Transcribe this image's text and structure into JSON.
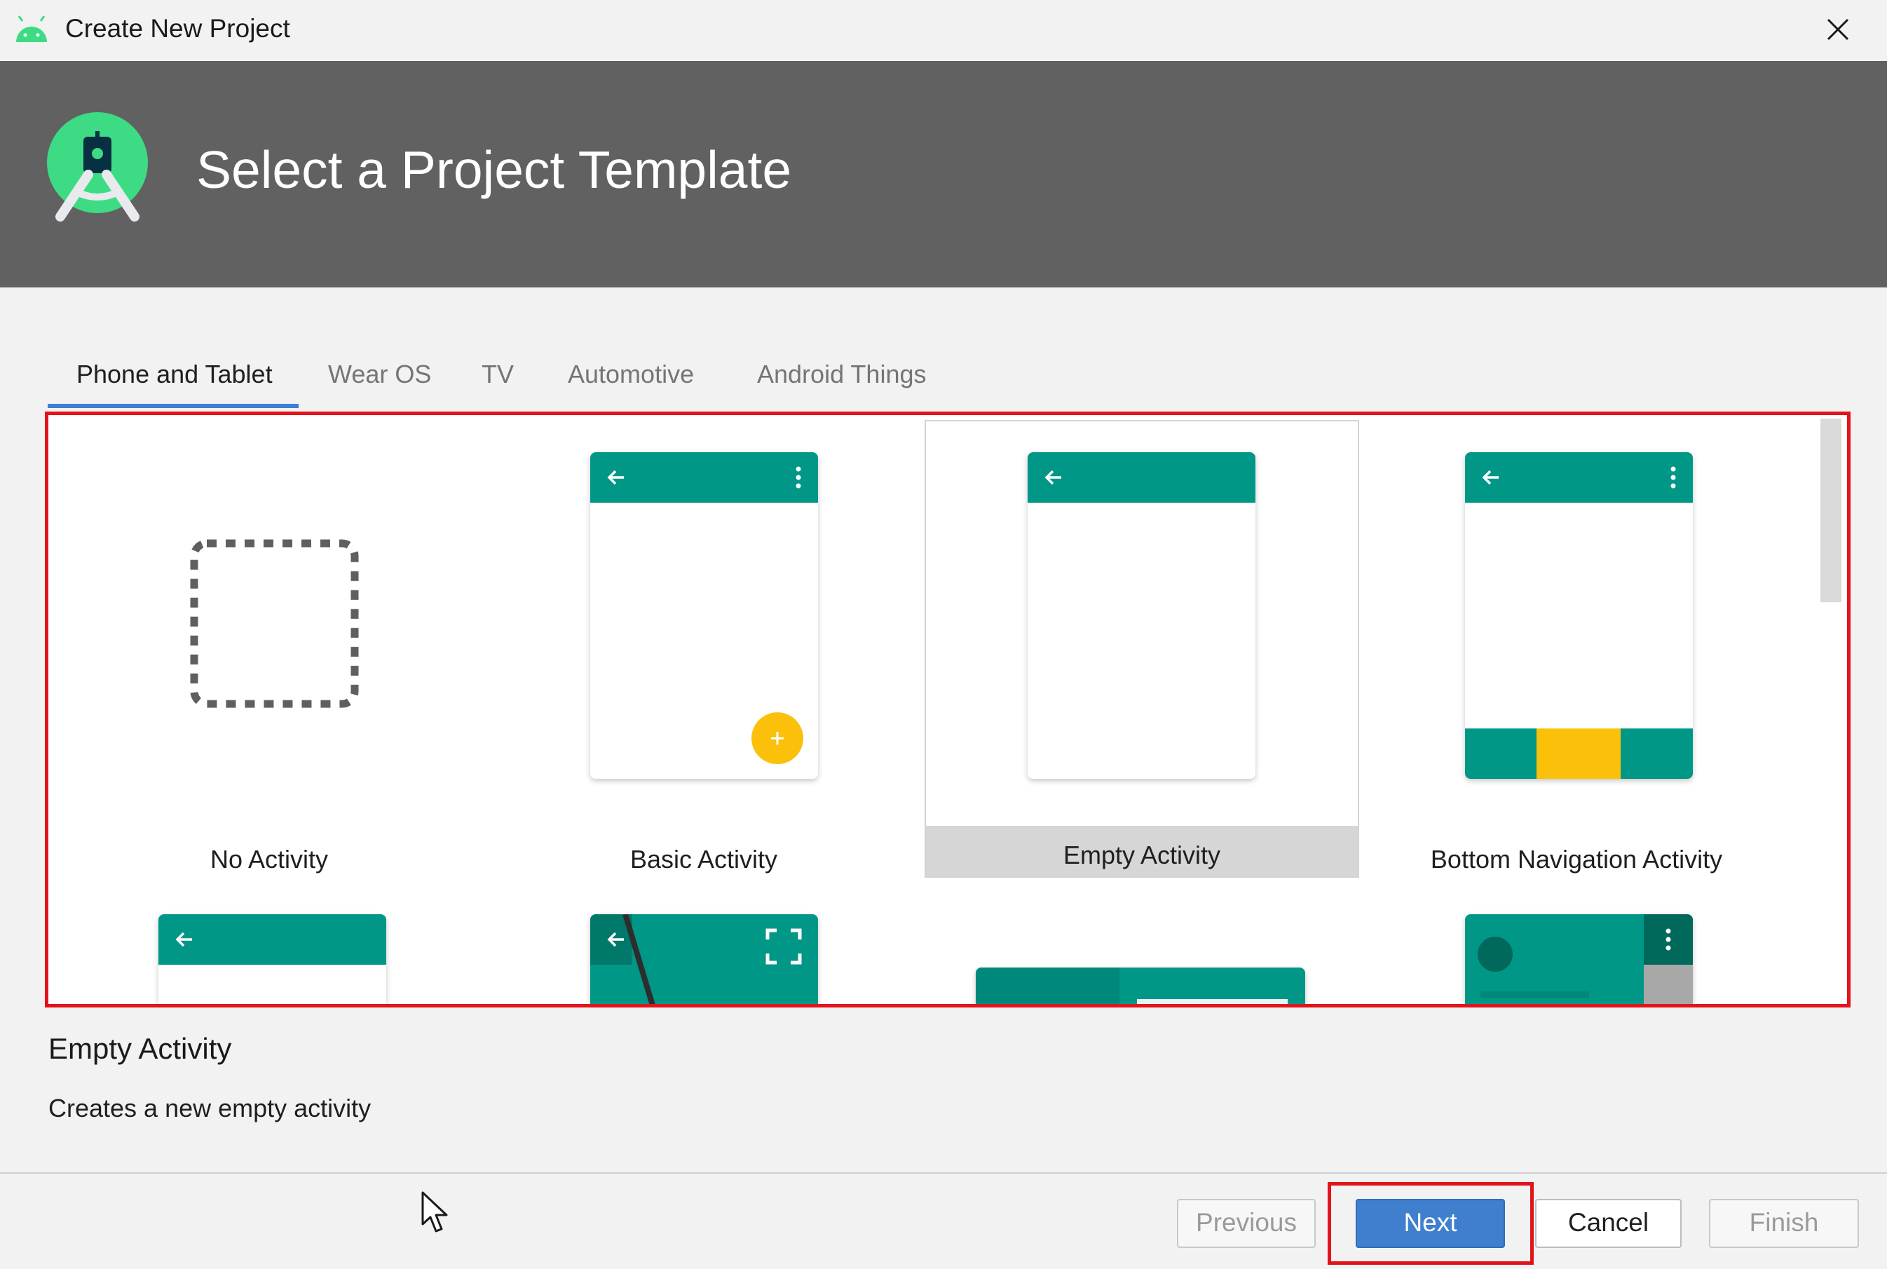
{
  "window": {
    "title": "Create New Project"
  },
  "header": {
    "title": "Select a Project Template"
  },
  "tabs": [
    {
      "label": "Phone and Tablet",
      "active": true
    },
    {
      "label": "Wear OS",
      "active": false
    },
    {
      "label": "TV",
      "active": false
    },
    {
      "label": "Automotive",
      "active": false
    },
    {
      "label": "Android Things",
      "active": false
    }
  ],
  "templates": [
    {
      "label": "No Activity",
      "selected": false
    },
    {
      "label": "Basic Activity",
      "selected": false
    },
    {
      "label": "Empty Activity",
      "selected": true
    },
    {
      "label": "Bottom Navigation Activity",
      "selected": false
    }
  ],
  "description": {
    "title": "Empty Activity",
    "text": "Creates a new empty activity"
  },
  "buttons": {
    "previous": "Previous",
    "next": "Next",
    "cancel": "Cancel",
    "finish": "Finish"
  },
  "colors": {
    "header_bg": "#616161",
    "teal": "#009787",
    "accent_yellow": "#fbc00a",
    "highlight_red": "#e2141b",
    "primary_blue": "#3f7fcd"
  },
  "icons": [
    "android-icon",
    "close-icon",
    "android-studio-logo",
    "back-arrow-icon",
    "overflow-menu-icon",
    "add-icon",
    "fullscreen-icon",
    "mouse-cursor"
  ]
}
